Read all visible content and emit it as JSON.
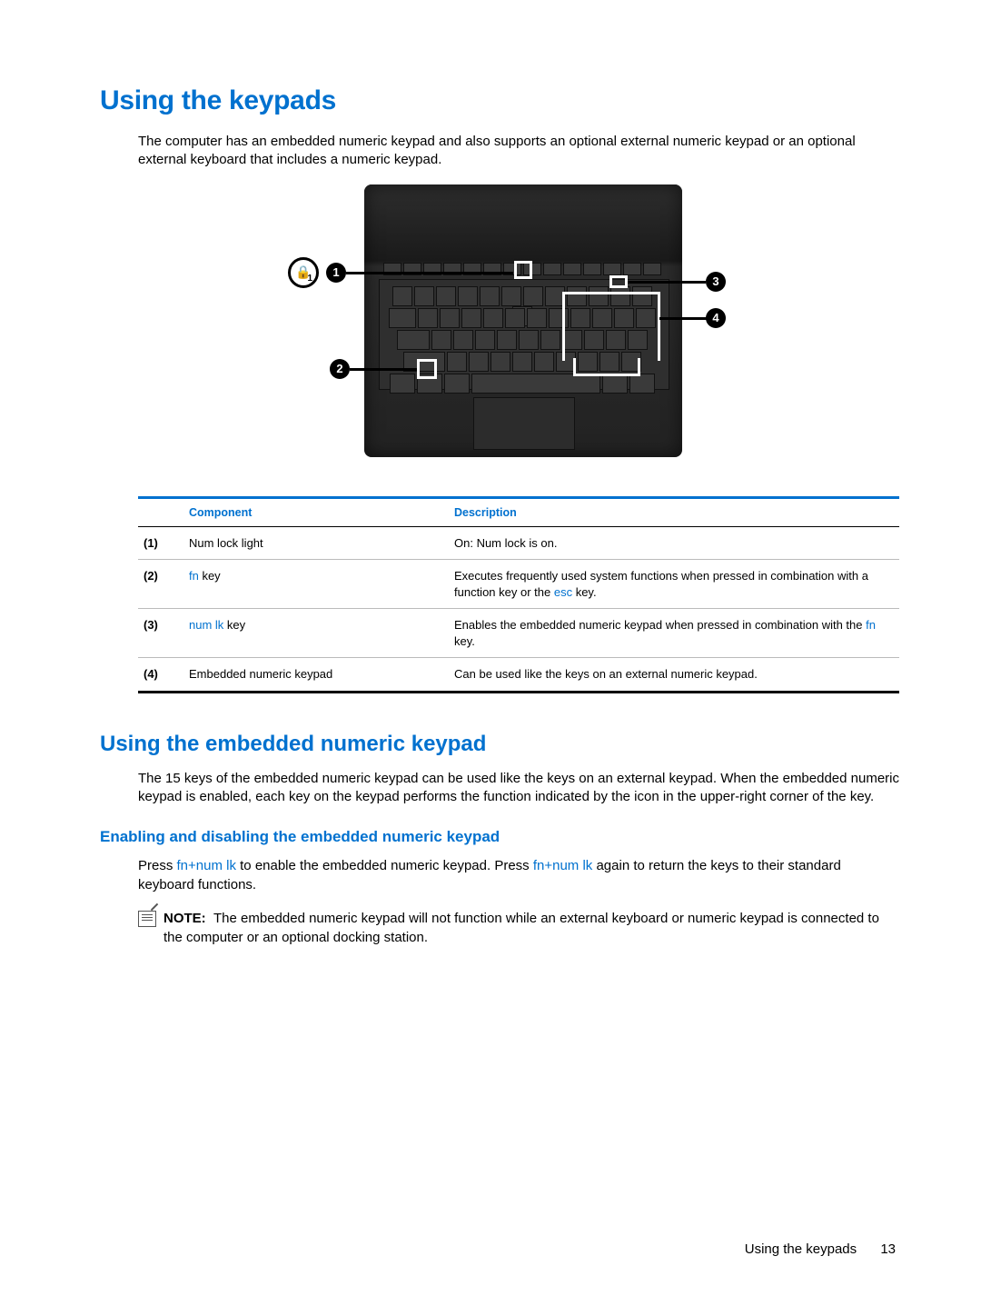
{
  "h1": "Using the keypads",
  "intro": "The computer has an embedded numeric keypad and also supports an optional external numeric keypad or an optional external keyboard that includes a numeric keypad.",
  "callouts": {
    "c1": "1",
    "c2": "2",
    "c3": "3",
    "c4": "4",
    "lock": "1"
  },
  "table": {
    "headers": {
      "component": "Component",
      "description": "Description"
    },
    "rows": [
      {
        "num": "(1)",
        "comp": {
          "pre": "",
          "kw": "",
          "post": "Num lock light"
        },
        "desc": {
          "pre": "On: Num lock is on.",
          "kw": "",
          "post": ""
        }
      },
      {
        "num": "(2)",
        "comp": {
          "pre": "",
          "kw": "fn",
          "post": " key"
        },
        "desc": {
          "pre": "Executes frequently used system functions when pressed in combination with a function key or the ",
          "kw": "esc",
          "post": " key."
        }
      },
      {
        "num": "(3)",
        "comp": {
          "pre": "",
          "kw": "num lk",
          "post": " key"
        },
        "desc": {
          "pre": "Enables the embedded numeric keypad when pressed in combination with the ",
          "kw": "fn",
          "post": " key."
        }
      },
      {
        "num": "(4)",
        "comp": {
          "pre": "",
          "kw": "",
          "post": "Embedded numeric keypad"
        },
        "desc": {
          "pre": "Can be used like the keys on an external numeric keypad.",
          "kw": "",
          "post": ""
        }
      }
    ]
  },
  "h2": "Using the embedded numeric keypad",
  "body2": "The 15 keys of the embedded numeric keypad can be used like the keys on an external keypad. When the embedded numeric keypad is enabled, each key on the keypad performs the function indicated by the icon in the upper-right corner of the key.",
  "h3": "Enabling and disabling the embedded numeric keypad",
  "enable": {
    "pre": "Press ",
    "kw1": "fn+num lk",
    "mid": " to enable the embedded numeric keypad. Press ",
    "kw2": "fn+num lk",
    "post": " again to return the keys to their standard keyboard functions."
  },
  "note": {
    "label": "NOTE:",
    "text": "The embedded numeric keypad will not function while an external keyboard or numeric keypad is connected to the computer or an optional docking station."
  },
  "footer": {
    "title": "Using the keypads",
    "page": "13"
  }
}
